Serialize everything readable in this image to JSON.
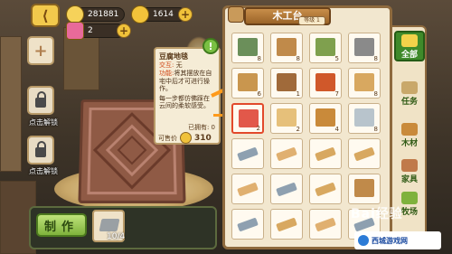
{
  "currency": {
    "gold": "281881",
    "coins": "1614",
    "gems": "2"
  },
  "left_slots": {
    "unlock_label_1": "点击解锁",
    "unlock_label_2": "点击解锁"
  },
  "tooltip": {
    "title": "豆腐地毯",
    "effect_key": "交互:",
    "effect_val": "无",
    "desc_key": "功能:",
    "desc": "将其摆放在自宅中后才可进行操作。",
    "flavor": "每一步都仿佛踩在云间的柔软感受。",
    "owned": "已拥有: 0",
    "price_label": "可售价",
    "price": "310"
  },
  "panel": {
    "title": "木工台",
    "level": "等级 1"
  },
  "craft": {
    "make_label": "制作",
    "material_count": "10/4"
  },
  "items": [
    {
      "icon": "bed-icon",
      "count": "8",
      "color": "#6b8f5a"
    },
    {
      "icon": "rocking-horse-icon",
      "count": "8",
      "color": "#c08a4a"
    },
    {
      "icon": "green-bench-icon",
      "count": "5",
      "color": "#7fa04e"
    },
    {
      "icon": "folding-chair-icon",
      "count": "8",
      "color": "#8a8a8a"
    },
    {
      "icon": "shelf-icon",
      "count": "6",
      "color": "#c9964e"
    },
    {
      "icon": "table-icon",
      "count": "1",
      "color": "#a06a3a"
    },
    {
      "icon": "red-cabinet-icon",
      "count": "7",
      "color": "#d0582a"
    },
    {
      "icon": "striped-box-icon",
      "count": "8",
      "color": "#d8a860"
    },
    {
      "icon": "tofu-rug-icon",
      "count": "2",
      "color": "#e2584a",
      "selected": true
    },
    {
      "icon": "tofu-block-icon",
      "count": "2",
      "color": "#e6c07a"
    },
    {
      "icon": "dog-house-icon",
      "count": "4",
      "color": "#c98a3a"
    },
    {
      "icon": "sink-icon",
      "count": "8",
      "color": "#b8c4cc"
    },
    {
      "icon": "pipe-icon",
      "count": "",
      "color": "#8ea0b0"
    },
    {
      "icon": "plank-icon",
      "count": "",
      "color": "#e0b070"
    },
    {
      "icon": "plank-icon",
      "count": "",
      "color": "#d8a860"
    },
    {
      "icon": "plank-icon",
      "count": "",
      "color": "#d8a860"
    },
    {
      "icon": "plank-icon",
      "count": "",
      "color": "#e0b070"
    },
    {
      "icon": "metal-bar-icon",
      "count": "",
      "color": "#8ea0b0"
    },
    {
      "icon": "plank-icon",
      "count": "",
      "color": "#d8a860"
    },
    {
      "icon": "chair-icon",
      "count": "",
      "color": "#c08a4a"
    },
    {
      "icon": "metal-bar-icon",
      "count": "",
      "color": "#8ea0b0"
    },
    {
      "icon": "plank-icon",
      "count": "",
      "color": "#d8a860"
    },
    {
      "icon": "plank-icon",
      "count": "",
      "color": "#e0b070"
    },
    {
      "icon": "metal-bar-icon",
      "count": "",
      "color": "#8ea0b0"
    }
  ],
  "tabs": [
    {
      "label": "全部",
      "icon": "star-icon",
      "active": true
    },
    {
      "label": "任务",
      "icon": "scroll-icon",
      "active": false
    },
    {
      "label": "木材",
      "icon": "wood-icon",
      "active": false
    },
    {
      "label": "家具",
      "icon": "furniture-icon",
      "active": false
    },
    {
      "label": "牧场",
      "icon": "ranch-icon",
      "active": false
    }
  ],
  "watermark": {
    "text": "Bai经验",
    "site": "西城游戏网"
  }
}
